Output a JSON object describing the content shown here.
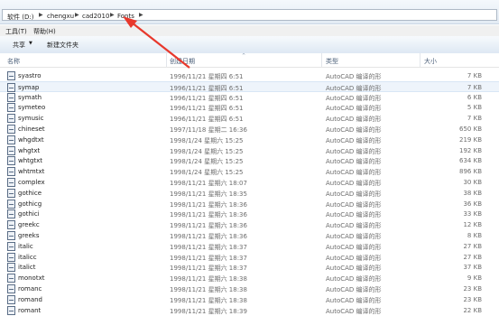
{
  "address": {
    "crumbs": [
      "软件 (D:)",
      "chengxu",
      "cad2010",
      "Fonts"
    ]
  },
  "menu": {
    "tools": "工具(T)",
    "help": "帮助(H)"
  },
  "commands": {
    "share": "共享",
    "new_folder": "新建文件夹"
  },
  "columns": {
    "name": "名称",
    "date": "创建日期",
    "type": "类型",
    "size": "大小"
  },
  "files": [
    {
      "name": "syastro",
      "date": "1996/11/21 星期四 6:51",
      "type": "AutoCAD 编译的形",
      "size": "7 KB"
    },
    {
      "name": "symap",
      "date": "1996/11/21 星期四 6:51",
      "type": "AutoCAD 编译的形",
      "size": "7 KB"
    },
    {
      "name": "symath",
      "date": "1996/11/21 星期四 6:51",
      "type": "AutoCAD 编译的形",
      "size": "6 KB"
    },
    {
      "name": "symeteo",
      "date": "1996/11/21 星期四 6:51",
      "type": "AutoCAD 编译的形",
      "size": "5 KB"
    },
    {
      "name": "symusic",
      "date": "1996/11/21 星期四 6:51",
      "type": "AutoCAD 编译的形",
      "size": "7 KB"
    },
    {
      "name": "chineset",
      "date": "1997/11/18 星期二 16:36",
      "type": "AutoCAD 编译的形",
      "size": "650 KB"
    },
    {
      "name": "whgdtxt",
      "date": "1998/1/24 星期六 15:25",
      "type": "AutoCAD 编译的形",
      "size": "219 KB"
    },
    {
      "name": "whgtxt",
      "date": "1998/1/24 星期六 15:25",
      "type": "AutoCAD 编译的形",
      "size": "192 KB"
    },
    {
      "name": "whtgtxt",
      "date": "1998/1/24 星期六 15:25",
      "type": "AutoCAD 编译的形",
      "size": "634 KB"
    },
    {
      "name": "whtmtxt",
      "date": "1998/1/24 星期六 15:25",
      "type": "AutoCAD 编译的形",
      "size": "896 KB"
    },
    {
      "name": "complex",
      "date": "1998/11/21 星期六 18:07",
      "type": "AutoCAD 编译的形",
      "size": "30 KB"
    },
    {
      "name": "gothice",
      "date": "1998/11/21 星期六 18:35",
      "type": "AutoCAD 编译的形",
      "size": "38 KB"
    },
    {
      "name": "gothicg",
      "date": "1998/11/21 星期六 18:36",
      "type": "AutoCAD 编译的形",
      "size": "36 KB"
    },
    {
      "name": "gothici",
      "date": "1998/11/21 星期六 18:36",
      "type": "AutoCAD 编译的形",
      "size": "33 KB"
    },
    {
      "name": "greekc",
      "date": "1998/11/21 星期六 18:36",
      "type": "AutoCAD 编译的形",
      "size": "12 KB"
    },
    {
      "name": "greeks",
      "date": "1998/11/21 星期六 18:36",
      "type": "AutoCAD 编译的形",
      "size": "8 KB"
    },
    {
      "name": "italic",
      "date": "1998/11/21 星期六 18:37",
      "type": "AutoCAD 编译的形",
      "size": "27 KB"
    },
    {
      "name": "italicc",
      "date": "1998/11/21 星期六 18:37",
      "type": "AutoCAD 编译的形",
      "size": "27 KB"
    },
    {
      "name": "italict",
      "date": "1998/11/21 星期六 18:37",
      "type": "AutoCAD 编译的形",
      "size": "37 KB"
    },
    {
      "name": "monotxt",
      "date": "1998/11/21 星期六 18:38",
      "type": "AutoCAD 编译的形",
      "size": "9 KB"
    },
    {
      "name": "romanc",
      "date": "1998/11/21 星期六 18:38",
      "type": "AutoCAD 编译的形",
      "size": "23 KB"
    },
    {
      "name": "romand",
      "date": "1998/11/21 星期六 18:38",
      "type": "AutoCAD 编译的形",
      "size": "23 KB"
    },
    {
      "name": "romant",
      "date": "1998/11/21 星期六 18:39",
      "type": "AutoCAD 编译的形",
      "size": "22 KB"
    }
  ],
  "selected_row": 1,
  "colors": {
    "annotation_arrow": "#e8382c",
    "header_text": "#4c607a",
    "selection": "#eef4fb"
  },
  "icons": {
    "file": "file-icon",
    "dropdown": "chevron-down-icon",
    "breadcrumb_sep": "chevron-right-icon"
  }
}
